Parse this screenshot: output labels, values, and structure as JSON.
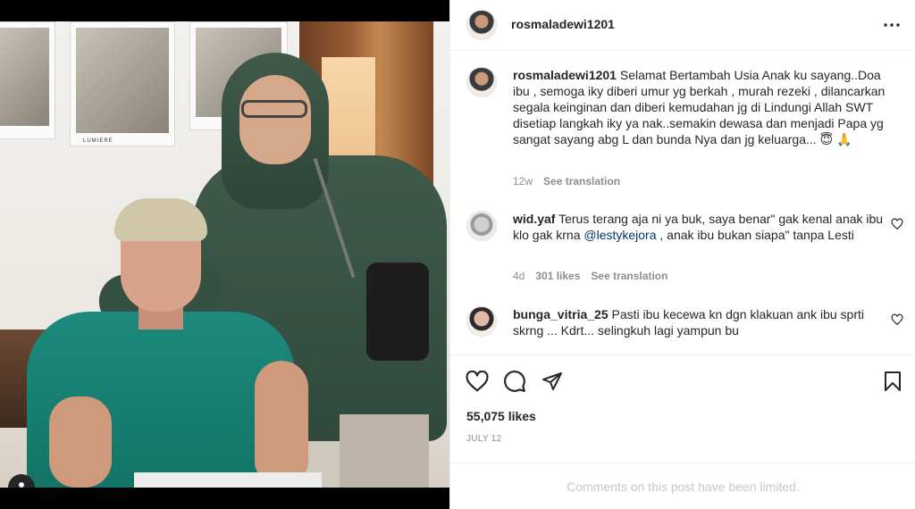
{
  "post": {
    "username": "rosmaladewi1201",
    "caption_user": "rosmaladewi1201",
    "caption_text": "Selamat Bertambah Usia Anak ku sayang..Doa ibu , semoga iky diberi umur yg berkah , murah rezeki , dilancarkan segala keinginan dan diberi kemudahan jg di Lindungi Allah SWT disetiap langkah iky ya nak..semakin dewasa dan menjadi Papa yg sangat sayang abg L dan bunda Nya dan jg keluarga... 😇 🙏",
    "caption_age": "12w",
    "see_translation": "See translation",
    "likes": "55,075 likes",
    "date": "JULY 12",
    "photo_caption": "LUMIERE"
  },
  "comments": [
    {
      "user": "wid.yaf",
      "text_before": "Terus terang aja ni ya buk, saya benar\" gak kenal anak ibu klo gak krna ",
      "mention": "@lestykejora",
      "text_after": " , anak ibu bukan siapa\" tanpa Lesti",
      "age": "4d",
      "likes": "301 likes",
      "see_translation": "See translation"
    },
    {
      "user": "bunga_vitria_25",
      "text": "Pasti ibu kecewa kn dgn klakuan ank ibu sprti skrng ... Kdrt... selingkuh lagi yampun bu"
    }
  ],
  "footer": {
    "limited": "Comments on this post have been limited."
  },
  "icons": {
    "more": "more-options-icon",
    "like": "heart-icon",
    "comment": "comment-icon",
    "share": "share-icon",
    "save": "bookmark-icon",
    "user_tag": "user-tag-icon"
  },
  "colors": {
    "text": "#262626",
    "secondary": "#8e8e8e",
    "mention": "#00376b",
    "border": "#efefef"
  }
}
